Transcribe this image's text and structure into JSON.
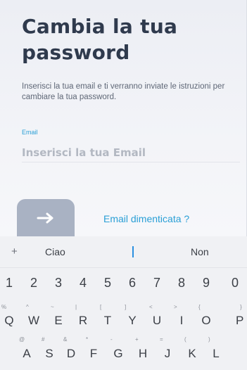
{
  "form": {
    "title": "Cambia la tua password",
    "description": "Inserisci la tua email e ti verranno inviate le istruzioni per cambiare la tua password.",
    "email_label": "Email",
    "email_placeholder": "Inserisci la tua Email",
    "submit_icon": "arrow-right-icon",
    "forgot_link": "Email dimenticata ?"
  },
  "keyboard": {
    "suggestions": {
      "plus": "+",
      "left": "Ciao",
      "right": "Non"
    },
    "number_row": [
      "1",
      "2",
      "3",
      "4",
      "5",
      "6",
      "7",
      "8",
      "9",
      "0"
    ],
    "qwerty_row": [
      {
        "sup": "%",
        "key": "Q"
      },
      {
        "sup": "^",
        "key": "W"
      },
      {
        "sup": "~",
        "key": "E"
      },
      {
        "sup": "|",
        "key": "R"
      },
      {
        "sup": "[",
        "key": "T"
      },
      {
        "sup": "]",
        "key": "Y"
      },
      {
        "sup": "<",
        "key": "U"
      },
      {
        "sup": ">",
        "key": "I"
      },
      {
        "sup": "{",
        "key": "O"
      },
      {
        "sup": "}",
        "key": "P"
      }
    ],
    "asdf_row": [
      {
        "sup": "@",
        "key": "A"
      },
      {
        "sup": "#",
        "key": "S"
      },
      {
        "sup": "&",
        "key": "D"
      },
      {
        "sup": "*",
        "key": "F"
      },
      {
        "sup": "-",
        "key": "G"
      },
      {
        "sup": "+",
        "key": "H"
      },
      {
        "sup": "=",
        "key": "J"
      },
      {
        "sup": "(",
        "key": "K"
      },
      {
        "sup": ")",
        "key": "L"
      }
    ]
  },
  "colors": {
    "accent": "#2a9fd6",
    "title": "#2f3a4d",
    "button": "#a9b2c3"
  }
}
